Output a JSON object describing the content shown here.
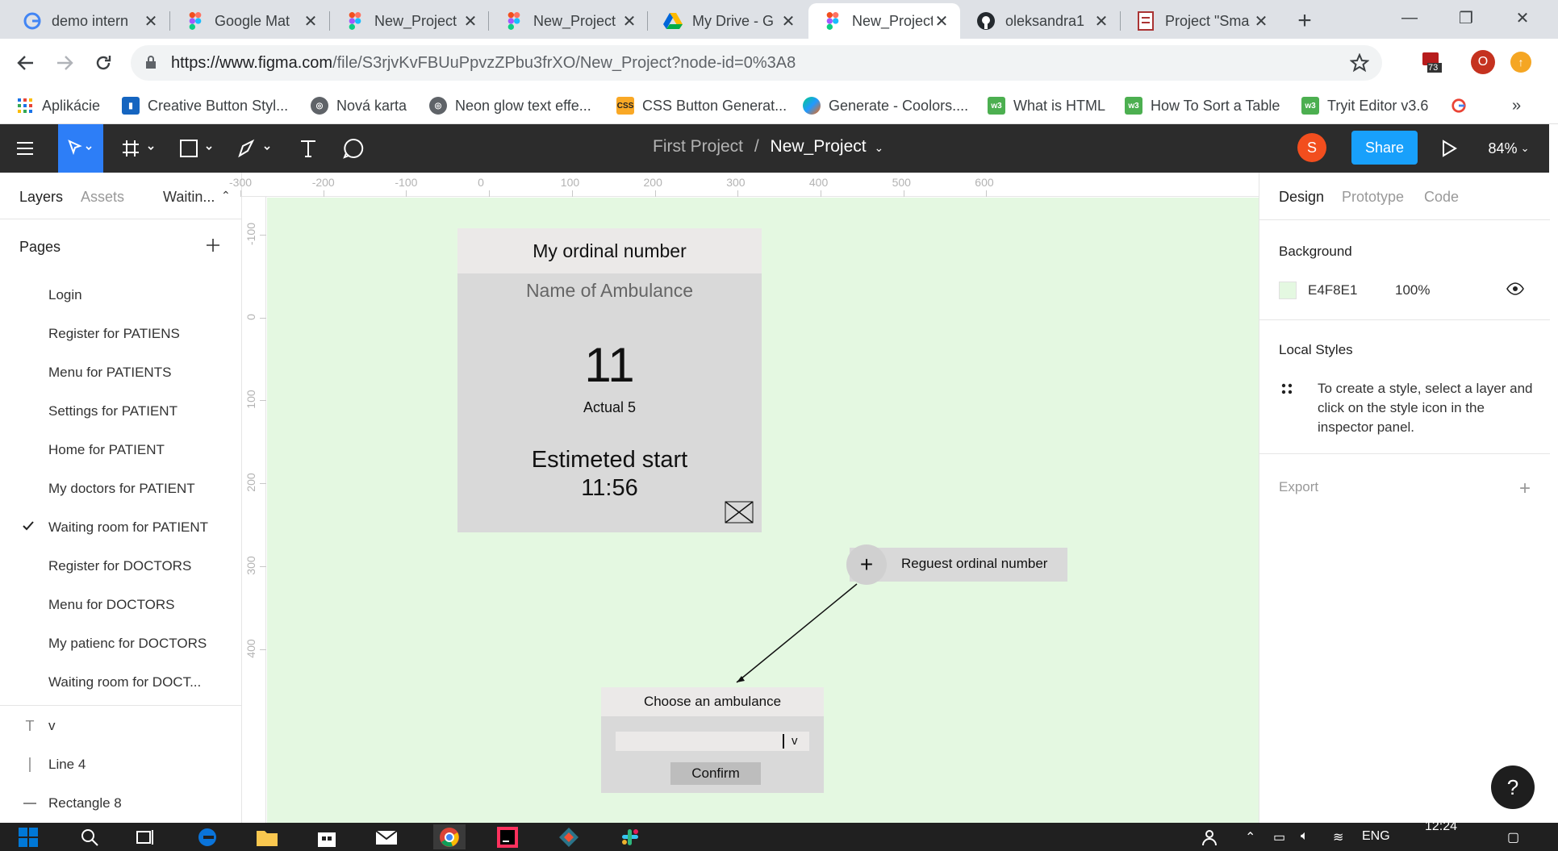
{
  "browser": {
    "tabs": [
      {
        "title": "demo intern",
        "icon": "google-icon",
        "active": false
      },
      {
        "title": "Google Mat",
        "icon": "figma-icon",
        "active": false
      },
      {
        "title": "New_Project",
        "icon": "figma-icon",
        "active": false
      },
      {
        "title": "New_Project",
        "icon": "figma-icon",
        "active": false
      },
      {
        "title": "My Drive - G",
        "icon": "google-drive-icon",
        "active": false
      },
      {
        "title": "New_Project",
        "icon": "figma-icon",
        "active": true
      },
      {
        "title": "oleksandra1",
        "icon": "github-icon",
        "active": false
      },
      {
        "title": "Project \"Sma",
        "icon": "document-icon",
        "active": false
      }
    ],
    "url_host": "https://www.figma.com",
    "url_path": "/file/S3rjvKvFBUuPpvzZPbu3frXO/New_Project?node-id=0%3A8",
    "ext_badge": "73",
    "profile_initial": "O",
    "bookmarks": [
      {
        "label": "Aplikácie",
        "icon": "apps-grid-icon"
      },
      {
        "label": "Creative Button Styl...",
        "icon": "bookmark-icon"
      },
      {
        "label": "Nová karta",
        "icon": "globe-icon"
      },
      {
        "label": "Neon glow text effe...",
        "icon": "globe-icon"
      },
      {
        "label": "CSS Button Generat...",
        "icon": "css-icon"
      },
      {
        "label": "Generate - Coolors....",
        "icon": "coolors-icon"
      },
      {
        "label": "What is HTML",
        "icon": "w3-icon"
      },
      {
        "label": "How To Sort a Table",
        "icon": "w3-icon"
      },
      {
        "label": "Tryit Editor v3.6",
        "icon": "w3-icon"
      }
    ]
  },
  "figma": {
    "breadcrumb_parent": "First Project",
    "breadcrumb_sep": "/",
    "file_name": "New_Project",
    "avatar_initial": "S",
    "share_label": "Share",
    "zoom": "84%",
    "left_tabs": [
      "Layers",
      "Assets",
      "Waitin..."
    ],
    "pages_heading": "Pages",
    "pages": [
      {
        "name": "Login",
        "current": false
      },
      {
        "name": "Register for PATIENS",
        "current": false
      },
      {
        "name": "Menu for PATIENTS",
        "current": false
      },
      {
        "name": "Settings for PATIENT",
        "current": false
      },
      {
        "name": "Home for PATIENT",
        "current": false
      },
      {
        "name": "My doctors for PATIENT",
        "current": false
      },
      {
        "name": "Waiting room for PATIENT",
        "current": true
      },
      {
        "name": "Register for DOCTORS",
        "current": false
      },
      {
        "name": "Menu for DOCTORS",
        "current": false
      },
      {
        "name": "My patienc for DOCTORS",
        "current": false
      },
      {
        "name": "Waiting room for DOCT...",
        "current": false
      }
    ],
    "layers": [
      {
        "name": "v",
        "icon": "text-layer-icon"
      },
      {
        "name": "Line 4",
        "icon": "line-layer-icon"
      },
      {
        "name": "Rectangle 8",
        "icon": "rectangle-layer-icon"
      }
    ],
    "ruler_h": [
      "-300",
      "-200",
      "-100",
      "0",
      "100",
      "200",
      "300",
      "400",
      "500",
      "600"
    ],
    "ruler_v": [
      "-100",
      "0",
      "100",
      "200",
      "300",
      "400"
    ],
    "right_tabs": [
      "Design",
      "Prototype",
      "Code"
    ],
    "background_heading": "Background",
    "background_hex": "E4F8E1",
    "background_opacity": "100%",
    "background_color": "#e4f8e1",
    "local_styles_heading": "Local Styles",
    "local_styles_hint": "To create a style, select a layer and click on the style icon in the inspector panel.",
    "export_heading": "Export",
    "help_label": "?"
  },
  "canvas": {
    "card": {
      "header": "My ordinal number",
      "ambulance": "Name of Ambulance",
      "number": "11",
      "actual": "Actual 5",
      "estimated_label": "Estimeted start",
      "estimated_time": "11:56"
    },
    "request_button": {
      "plus": "+",
      "label": "Reguest ordinal number"
    },
    "choose": {
      "header": "Choose an ambulance",
      "dropdown_arrow": "v",
      "confirm": "Confirm"
    }
  },
  "taskbar": {
    "lang": "ENG",
    "time": "12:24"
  }
}
